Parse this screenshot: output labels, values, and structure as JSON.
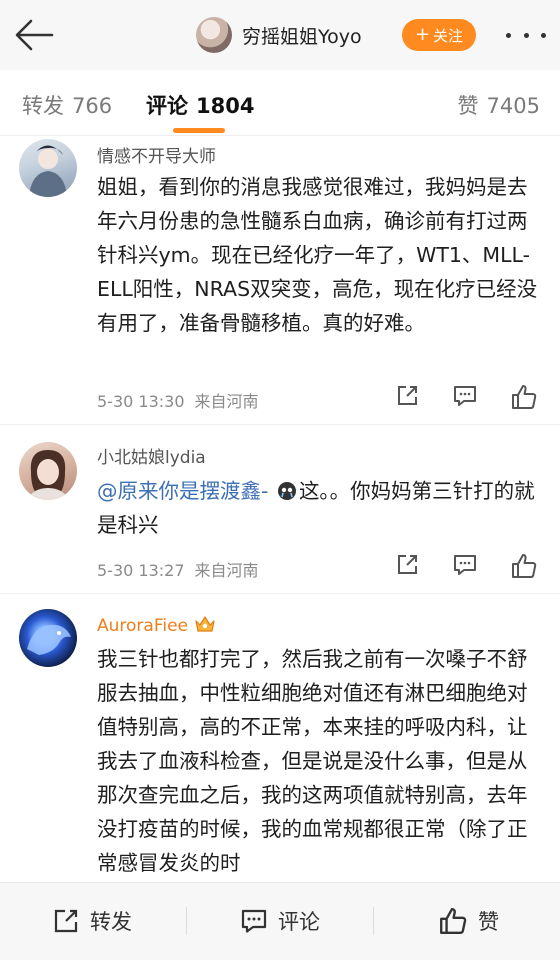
{
  "header": {
    "author_name": "穷摇姐姐Yoyo",
    "follow_label": "关注",
    "follow_plus": "+"
  },
  "tabs": [
    {
      "label": "转发",
      "count": "766"
    },
    {
      "label": "评论",
      "count": "1804"
    },
    {
      "label": "赞",
      "count": "7405"
    }
  ],
  "comments": [
    {
      "user": "情感不开导大师",
      "text": "姐姐，看到你的消息我感觉很难过，我妈妈是去年六月份患的急性髓系白血病，确诊前有打过两针科兴ym。现在已经化疗一年了，WT1、MLL-ELL阳性，NRAS双突变，高危，现在化疗已经没有用了，准备骨髓移植。真的好难。",
      "time": "5-30 13:30",
      "location": "来自河南"
    },
    {
      "user": "小北姑娘lydia",
      "mention": "@原来你是摆渡鑫-",
      "text": "这。。你妈妈第三针打的就是科兴",
      "time": "5-30 13:27",
      "location": "来自河南"
    },
    {
      "user": "AuroraFiee",
      "text": "我三针也都打完了，然后我之前有一次嗓子不舒服去抽血，中性粒细胞绝对值还有淋巴细胞绝对值特别高，高的不正常，本来挂的呼吸内科，让我去了血液科检查，但是说是没什么事，但是从那次查完血之后，我的这两项值就特别高，去年没打疫苗的时候，我的血常规都很正常（除了正常感冒发炎的时"
    }
  ],
  "bottom_bar": {
    "repost_label": "转发",
    "comment_label": "评论",
    "like_label": "赞"
  },
  "colors": {
    "accent": "#ff8a1f",
    "mention": "#3d6fb6",
    "vip_name": "#f07d19"
  }
}
